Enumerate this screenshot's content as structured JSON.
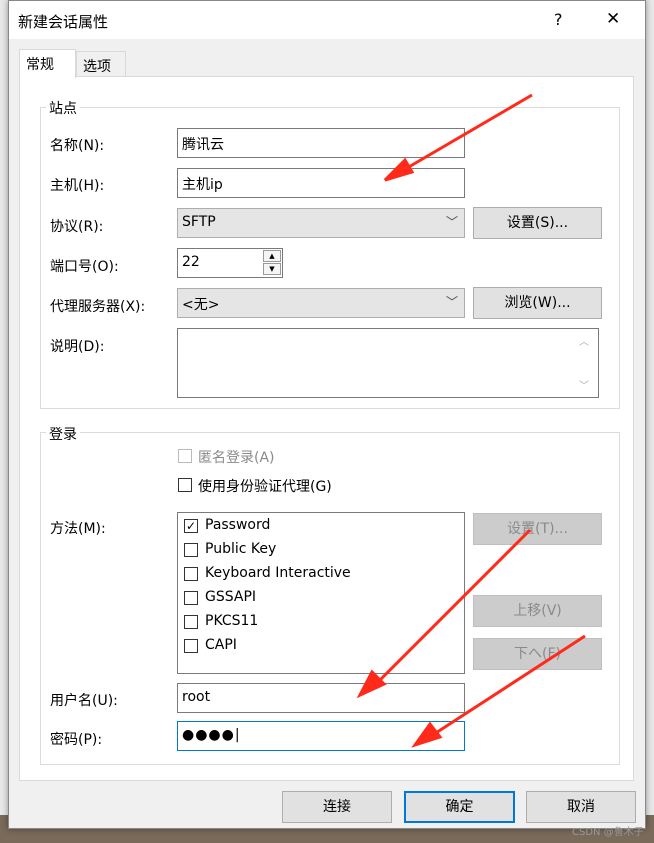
{
  "dialog": {
    "title": "新建会话属性",
    "help": "?",
    "close": "✕"
  },
  "tabs": [
    {
      "label": "常规"
    },
    {
      "label": "选项"
    }
  ],
  "site": {
    "group": "站点",
    "name_label": "名称(N):",
    "name_value": "腾讯云",
    "host_label": "主机(H):",
    "host_value": "主机ip",
    "protocol_label": "协议(R):",
    "protocol_value": "SFTP",
    "settings_button": "设置(S)...",
    "port_label": "端口号(O):",
    "port_value": "22",
    "proxy_label": "代理服务器(X):",
    "proxy_value": "<无>",
    "browse_button": "浏览(W)...",
    "desc_label": "说明(D):",
    "desc_value": ""
  },
  "login": {
    "group": "登录",
    "anonymous": "匿名登录(A)",
    "agent": "使用身份验证代理(G)",
    "method_label": "方法(M):",
    "methods": [
      {
        "label": "Password",
        "checked": true
      },
      {
        "label": "Public Key",
        "checked": false
      },
      {
        "label": "Keyboard Interactive",
        "checked": false
      },
      {
        "label": "GSSAPI",
        "checked": false
      },
      {
        "label": "PKCS11",
        "checked": false
      },
      {
        "label": "CAPI",
        "checked": false
      }
    ],
    "method_settings": "设置(T)...",
    "move_up": "上移(V)",
    "move_down": "下へ(F)",
    "user_label": "用户名(U):",
    "user_value": "root",
    "pass_label": "密码(P):",
    "pass_value": "●●●●"
  },
  "footer": {
    "connect": "连接",
    "ok": "确定",
    "cancel": "取消"
  },
  "watermark": "CSDN @鲁木子",
  "annotation_color": "#ff2a1a"
}
